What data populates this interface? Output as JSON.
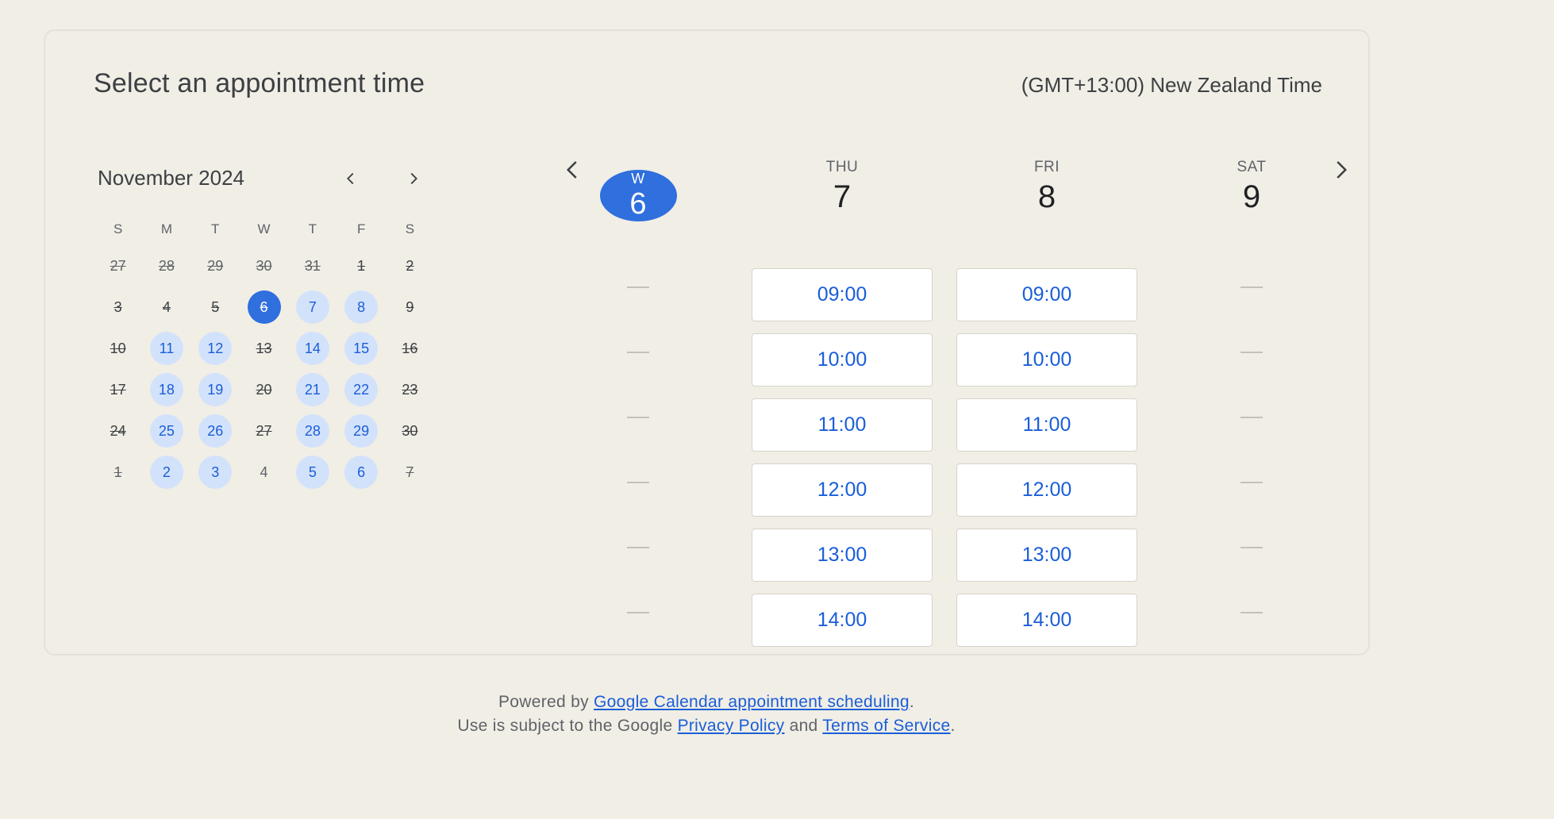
{
  "header": {
    "title": "Select an appointment time",
    "timezone": "(GMT+13:00) New Zealand Time"
  },
  "mini_calendar": {
    "month_label": "November 2024",
    "prev_icon": "chevron-left-icon",
    "next_icon": "chevron-right-icon",
    "weekdays": [
      "S",
      "M",
      "T",
      "W",
      "T",
      "F",
      "S"
    ],
    "weeks": [
      [
        {
          "d": "27",
          "s": "outside-unavailable"
        },
        {
          "d": "28",
          "s": "outside-unavailable"
        },
        {
          "d": "29",
          "s": "outside-unavailable"
        },
        {
          "d": "30",
          "s": "outside-unavailable"
        },
        {
          "d": "31",
          "s": "outside-unavailable"
        },
        {
          "d": "1",
          "s": "unavailable"
        },
        {
          "d": "2",
          "s": "unavailable"
        }
      ],
      [
        {
          "d": "3",
          "s": "unavailable"
        },
        {
          "d": "4",
          "s": "unavailable"
        },
        {
          "d": "5",
          "s": "unavailable"
        },
        {
          "d": "6",
          "s": "selected"
        },
        {
          "d": "7",
          "s": "available"
        },
        {
          "d": "8",
          "s": "available"
        },
        {
          "d": "9",
          "s": "unavailable"
        }
      ],
      [
        {
          "d": "10",
          "s": "unavailable"
        },
        {
          "d": "11",
          "s": "available"
        },
        {
          "d": "12",
          "s": "available"
        },
        {
          "d": "13",
          "s": "unavailable"
        },
        {
          "d": "14",
          "s": "available"
        },
        {
          "d": "15",
          "s": "available"
        },
        {
          "d": "16",
          "s": "unavailable"
        }
      ],
      [
        {
          "d": "17",
          "s": "unavailable"
        },
        {
          "d": "18",
          "s": "available"
        },
        {
          "d": "19",
          "s": "available"
        },
        {
          "d": "20",
          "s": "unavailable"
        },
        {
          "d": "21",
          "s": "available"
        },
        {
          "d": "22",
          "s": "available"
        },
        {
          "d": "23",
          "s": "unavailable"
        }
      ],
      [
        {
          "d": "24",
          "s": "unavailable"
        },
        {
          "d": "25",
          "s": "available"
        },
        {
          "d": "26",
          "s": "available"
        },
        {
          "d": "27",
          "s": "unavailable"
        },
        {
          "d": "28",
          "s": "available"
        },
        {
          "d": "29",
          "s": "available"
        },
        {
          "d": "30",
          "s": "unavailable"
        }
      ],
      [
        {
          "d": "1",
          "s": "outside-unavailable"
        },
        {
          "d": "2",
          "s": "available"
        },
        {
          "d": "3",
          "s": "available"
        },
        {
          "d": "4",
          "s": "outside"
        },
        {
          "d": "5",
          "s": "available"
        },
        {
          "d": "6",
          "s": "available"
        },
        {
          "d": "7",
          "s": "outside-unavailable"
        }
      ]
    ]
  },
  "week_view": {
    "prev_icon": "chevron-left-icon",
    "next_icon": "chevron-right-icon",
    "days": [
      {
        "dow": "W",
        "num": "6",
        "selected": true,
        "slots": []
      },
      {
        "dow": "THU",
        "num": "7",
        "selected": false,
        "slots": [
          "09:00",
          "10:00",
          "11:00",
          "12:00",
          "13:00",
          "14:00"
        ]
      },
      {
        "dow": "FRI",
        "num": "8",
        "selected": false,
        "slots": [
          "09:00",
          "10:00",
          "11:00",
          "12:00",
          "13:00",
          "14:00"
        ]
      },
      {
        "dow": "SAT",
        "num": "9",
        "selected": false,
        "slots": []
      }
    ],
    "empty_rows": 6
  },
  "footer": {
    "powered_by": "Powered by ",
    "powered_link": "Google Calendar appointment scheduling",
    "period1": ".",
    "use_subject": "Use is subject to the Google ",
    "privacy_link": "Privacy Policy",
    "and": " and ",
    "terms_link": "Terms of Service",
    "period2": "."
  },
  "colors": {
    "background": "#f1eee6",
    "accent": "#2f6fde",
    "available_bg": "#d3e2fb",
    "link": "#1a5ed8"
  }
}
